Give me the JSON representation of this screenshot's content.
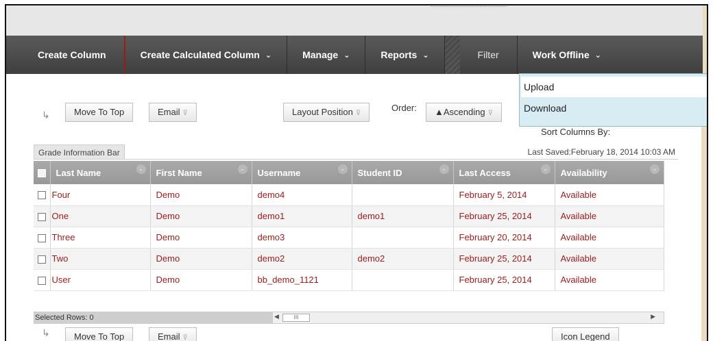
{
  "action_bar": {
    "create_column": "Create Column",
    "create_calculated_column": "Create Calculated Column",
    "manage": "Manage",
    "reports": "Reports",
    "filter": "Filter",
    "work_offline": "Work Offline"
  },
  "work_offline_menu": {
    "items": [
      "Upload",
      "Download"
    ]
  },
  "toolbar": {
    "move_to_top": "Move To Top",
    "email": "Email",
    "layout_position": "Layout Position",
    "order_label": "Order:",
    "ascending": "▲Ascending",
    "sort_columns_by": "Sort Columns By:"
  },
  "info_bar": {
    "label": "Grade Information Bar",
    "last_saved": "Last Saved:February 18, 2014 10:03 AM"
  },
  "grid": {
    "columns": [
      "Last Name",
      "First Name",
      "Username",
      "Student ID",
      "Last Access",
      "Availability"
    ],
    "rows": [
      [
        "Four",
        "Demo",
        "demo4",
        "",
        "February 5, 2014",
        "Available"
      ],
      [
        "One",
        "Demo",
        "demo1",
        "demo1",
        "February 25, 2014",
        "Available"
      ],
      [
        "Three",
        "Demo",
        "demo3",
        "",
        "February 20, 2014",
        "Available"
      ],
      [
        "Two",
        "Demo",
        "demo2",
        "demo2",
        "February 25, 2014",
        "Available"
      ],
      [
        "User",
        "Demo",
        "bb_demo_1121",
        "",
        "February 25, 2014",
        "Available"
      ]
    ]
  },
  "footer": {
    "selected_rows": "Selected Rows: 0",
    "scroll_thumb": "III",
    "move_to_top": "Move To Top",
    "email": "Email",
    "icon_legend": "Icon Legend"
  },
  "colors": {
    "link_red": "#9b1b1b",
    "action_bar": "#4a4a4a",
    "header_gray": "#a0a0a0",
    "dropdown_bg": "#d8edf3"
  }
}
